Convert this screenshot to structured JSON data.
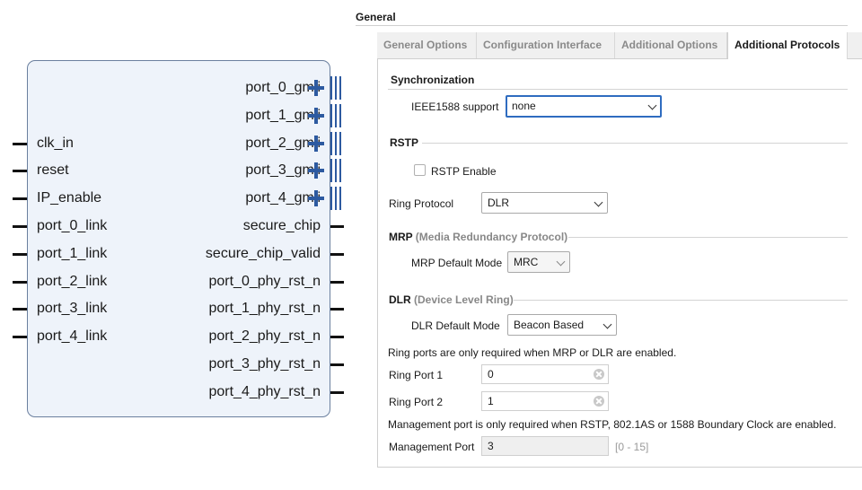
{
  "block": {
    "left_pins": [
      "clk_in",
      "reset",
      "IP_enable",
      "port_0_link",
      "port_1_link",
      "port_2_link",
      "port_3_link",
      "port_4_link"
    ],
    "bus_pins": [
      "port_0_gmii",
      "port_1_gmii",
      "port_2_gmii",
      "port_3_gmii",
      "port_4_gmii"
    ],
    "right_pins": [
      "secure_chip",
      "secure_chip_valid",
      "port_0_phy_rst_n",
      "port_1_phy_rst_n",
      "port_2_phy_rst_n",
      "port_3_phy_rst_n",
      "port_4_phy_rst_n"
    ],
    "bus_icon": "plus-expand-icon"
  },
  "panel": {
    "title": "General",
    "tabs": [
      {
        "label": "General Options",
        "active": false
      },
      {
        "label": "Configuration Interface",
        "active": false
      },
      {
        "label": "Additional Options",
        "active": false
      },
      {
        "label": "Additional Protocols",
        "active": true
      }
    ],
    "sync": {
      "heading": "Synchronization",
      "ieee_label": "IEEE1588 support",
      "ieee_value": "none"
    },
    "rstp": {
      "heading": "RSTP",
      "enable_label": "RSTP Enable",
      "enable_checked": false,
      "ring_protocol_label": "Ring Protocol",
      "ring_protocol_value": "DLR"
    },
    "mrp": {
      "heading": "MRP",
      "heading_sub": "(Media Redundancy Protocol)",
      "mode_label": "MRP Default Mode",
      "mode_value": "MRC"
    },
    "dlr": {
      "heading": "DLR",
      "heading_sub": "(Device Level Ring)",
      "mode_label": "DLR Default Mode",
      "mode_value": "Beacon Based"
    },
    "ring_note": "Ring ports are only required when MRP or DLR are enabled.",
    "ring_port1_label": "Ring Port 1",
    "ring_port1_value": "0",
    "ring_port2_label": "Ring Port 2",
    "ring_port2_value": "1",
    "mgmt_note": "Management port is only required when RSTP, 802.1AS or 1588 Boundary Clock are enabled.",
    "mgmt_label": "Management Port",
    "mgmt_value": "3",
    "mgmt_range": "[0 - 15]",
    "colors": {
      "accent": "#2f6cc0",
      "bus": "#2d5aa0",
      "block_fill": "#eef3fa"
    }
  }
}
